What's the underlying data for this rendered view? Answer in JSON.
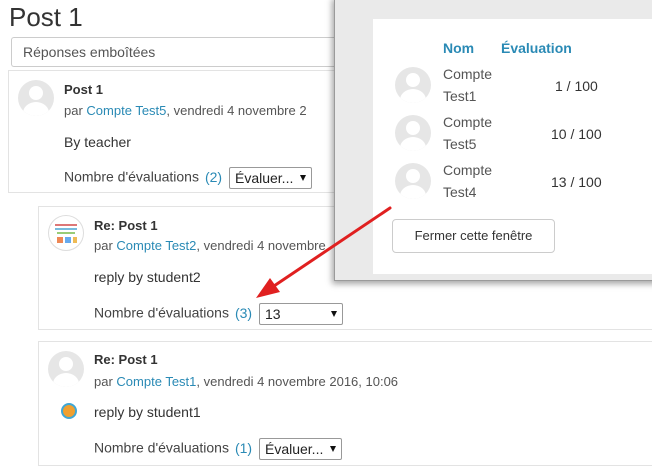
{
  "page": {
    "title": "Post 1",
    "mode": "Réponses emboîtées"
  },
  "colors": {
    "link": "#2a8ab5",
    "arrow": "#e02020"
  },
  "posts": [
    {
      "subject": "Post 1",
      "by_prefix": "par",
      "author": "Compte Test5",
      "date": ", vendredi 4 novembre 2",
      "message": "By teacher",
      "rating_label": "Nombre d'évaluations",
      "rating_count": "(2)",
      "rating_value": "Évaluer..."
    },
    {
      "subject": "Re: Post 1",
      "by_prefix": "par",
      "author": "Compte Test2",
      "date": ", vendredi 4 novembre",
      "message": "reply by student2",
      "rating_label": "Nombre d'évaluations",
      "rating_count": "(3)",
      "rating_value": "13"
    },
    {
      "subject": "Re: Post 1",
      "by_prefix": "par",
      "author": "Compte Test1",
      "date": ", vendredi 4 novembre 2016, 10:06",
      "message": "reply by student1",
      "rating_label": "Nombre d'évaluations",
      "rating_count": "(1)",
      "rating_value": "Évaluer..."
    }
  ],
  "popup": {
    "col_name": "Nom",
    "col_rating": "Évaluation",
    "rows": [
      {
        "name_line1": "Compte",
        "name_line2": "Test1",
        "rating": "1 / 100"
      },
      {
        "name_line1": "Compte",
        "name_line2": "Test5",
        "rating": "10 / 100"
      },
      {
        "name_line1": "Compte",
        "name_line2": "Test4",
        "rating": "13 / 100"
      }
    ],
    "close_label": "Fermer cette fenêtre"
  }
}
